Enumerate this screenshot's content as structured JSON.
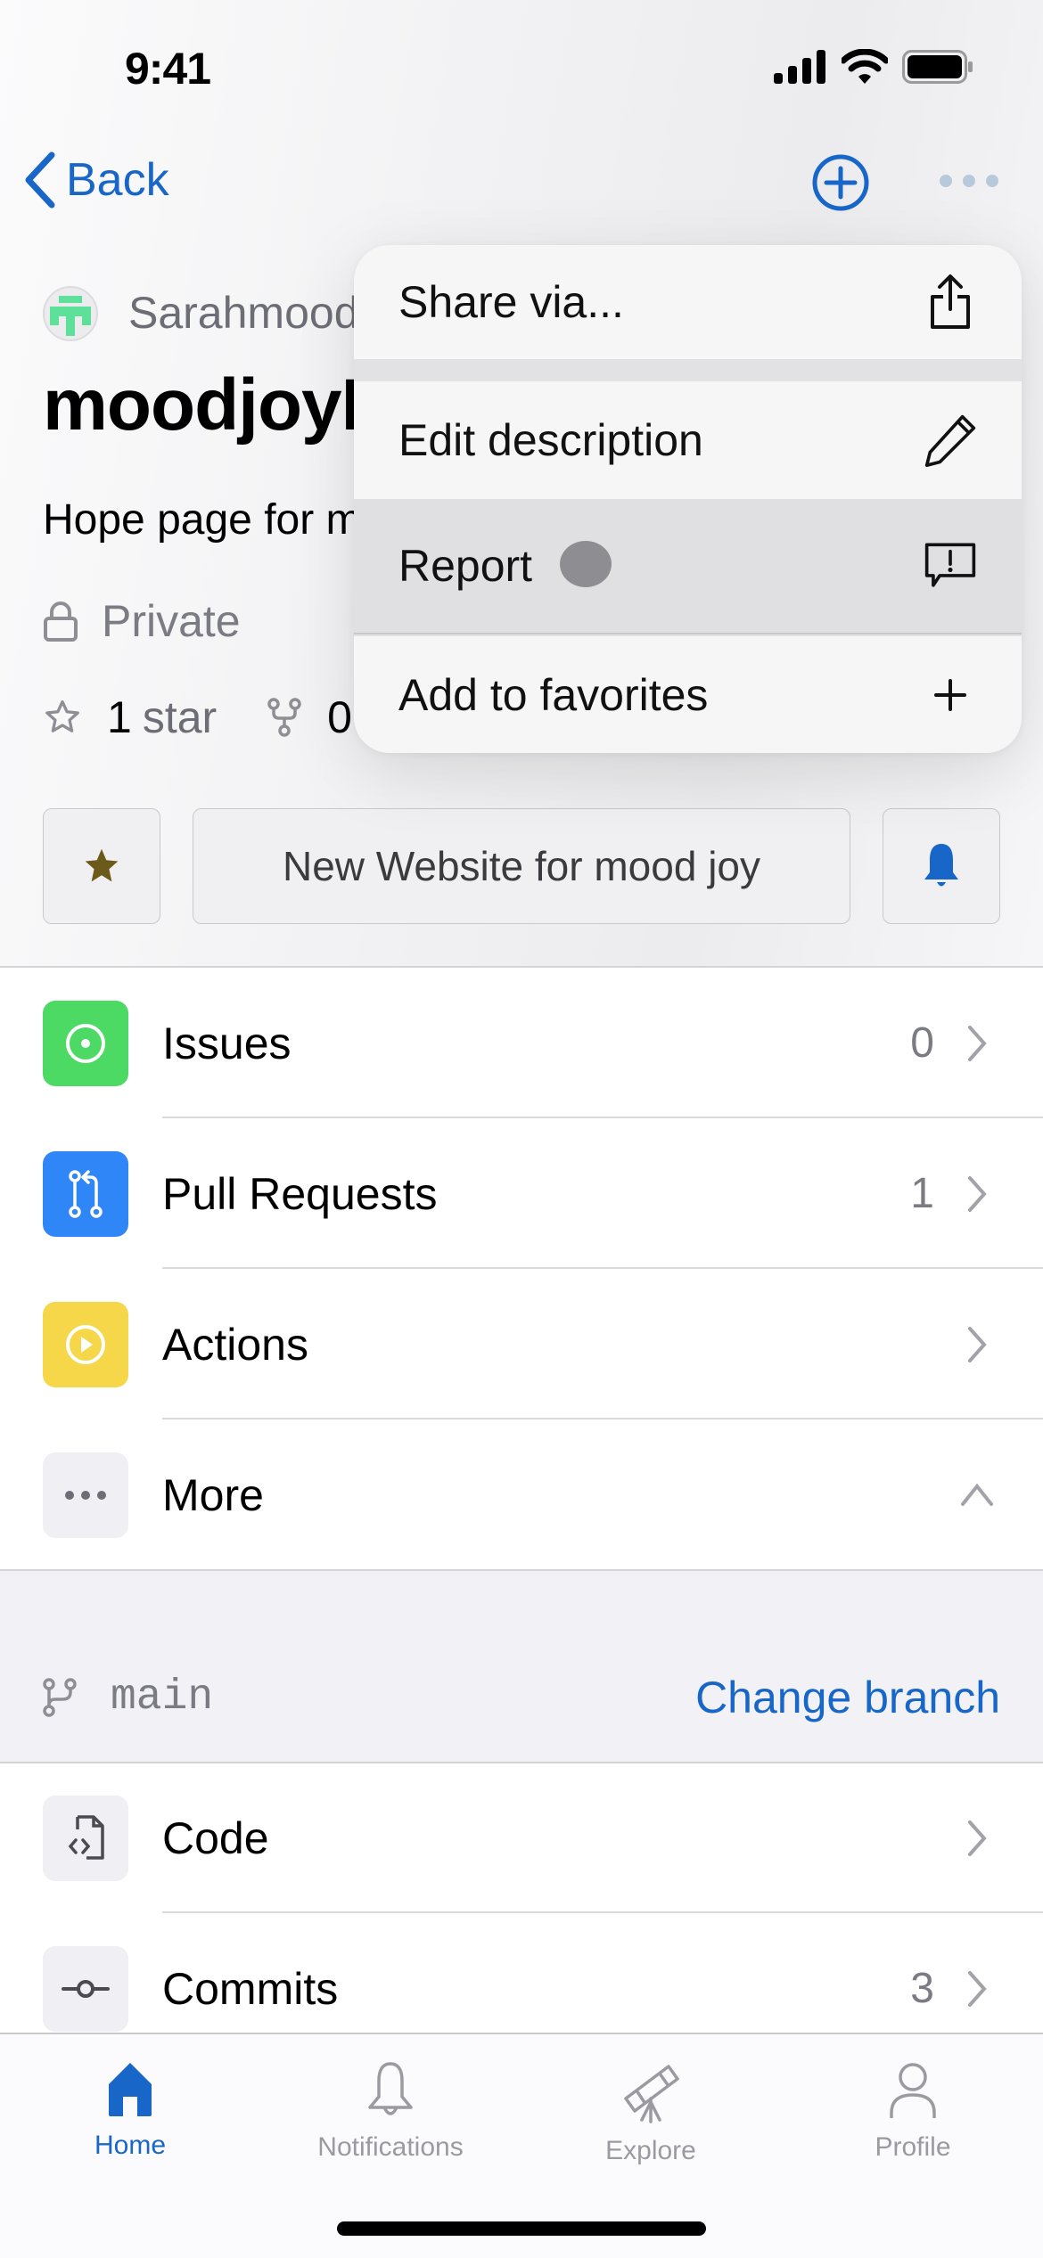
{
  "status_bar": {
    "time": "9:41"
  },
  "nav": {
    "back_label": "Back"
  },
  "repo": {
    "owner": "Sarahmoodjoy",
    "name": "moodjoyHope",
    "description": "Hope page for moodjoy",
    "visibility": "Private",
    "stars_count": "1",
    "stars_label": "star",
    "forks_count": "0"
  },
  "action_buttons": {
    "description_label": "New Website for mood joy"
  },
  "menu": {
    "items": [
      {
        "label": "Share via...",
        "icon": "share-icon"
      },
      {
        "label": "Edit description",
        "icon": "pencil-icon"
      },
      {
        "label": "Report",
        "icon": "report-icon",
        "pressed": true
      },
      {
        "label": "Add to favorites",
        "icon": "plus-icon"
      }
    ]
  },
  "sections": [
    {
      "label": "Issues",
      "count": "0",
      "icon": "issue-icon",
      "color": "#4cd964"
    },
    {
      "label": "Pull Requests",
      "count": "1",
      "icon": "pull-request-icon",
      "color": "#2f86f6"
    },
    {
      "label": "Actions",
      "count": "",
      "icon": "play-icon",
      "color": "#f7d74a"
    },
    {
      "label": "More",
      "count": "",
      "icon": "more-icon",
      "color": "#efeff4"
    }
  ],
  "branch": {
    "name": "main",
    "change_label": "Change branch"
  },
  "code_sections": [
    {
      "label": "Code",
      "count": "",
      "icon": "code-file-icon"
    },
    {
      "label": "Commits",
      "count": "3",
      "icon": "commit-icon"
    }
  ],
  "tabbar": {
    "tabs": [
      {
        "label": "Home",
        "active": true
      },
      {
        "label": "Notifications",
        "active": false
      },
      {
        "label": "Explore",
        "active": false
      },
      {
        "label": "Profile",
        "active": false
      }
    ]
  },
  "colors": {
    "accent": "#1867c8",
    "star": "#6b5a1a"
  }
}
